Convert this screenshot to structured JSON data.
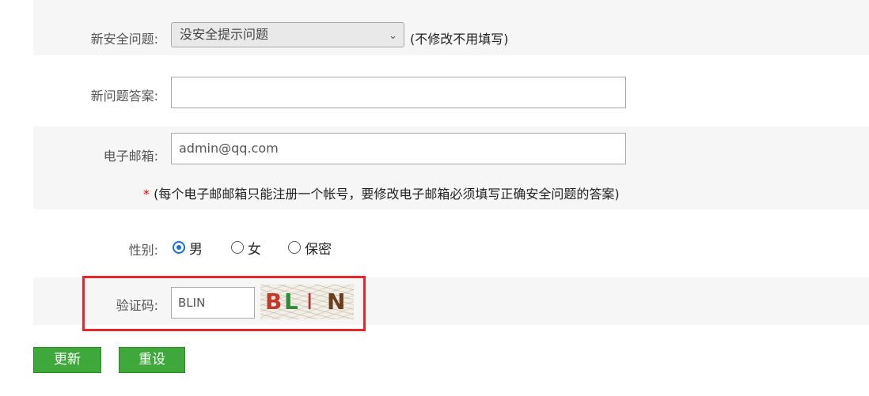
{
  "security_question": {
    "label": "新安全问题:",
    "selected": "没安全提示问题",
    "note": "(不修改不用填写)"
  },
  "answer": {
    "label": "新问题答案:",
    "value": ""
  },
  "email": {
    "label": "电子邮箱:",
    "value": "admin@qq.com",
    "required_mark": "*",
    "note": "(每个电子邮邮箱只能注册一个帐号，要修改电子邮箱必须填写正确安全问题的答案)"
  },
  "gender": {
    "label": "性别:",
    "options": [
      "男",
      "女",
      "保密"
    ],
    "selected": "男"
  },
  "captcha": {
    "label": "验证码:",
    "value": "BLIN",
    "image_chars": [
      {
        "char": "B",
        "color": "#c0392b"
      },
      {
        "char": "L",
        "color": "#2e8b3a"
      },
      {
        "char": "I",
        "color": "#b8323a"
      },
      {
        "char": "N",
        "color": "#6b3f1d"
      }
    ]
  },
  "buttons": {
    "update": "更新",
    "reset": "重设"
  },
  "colors": {
    "accent_green": "#3ea83a",
    "highlight_red": "#e8252b",
    "radio_blue": "#1a6ed8"
  }
}
